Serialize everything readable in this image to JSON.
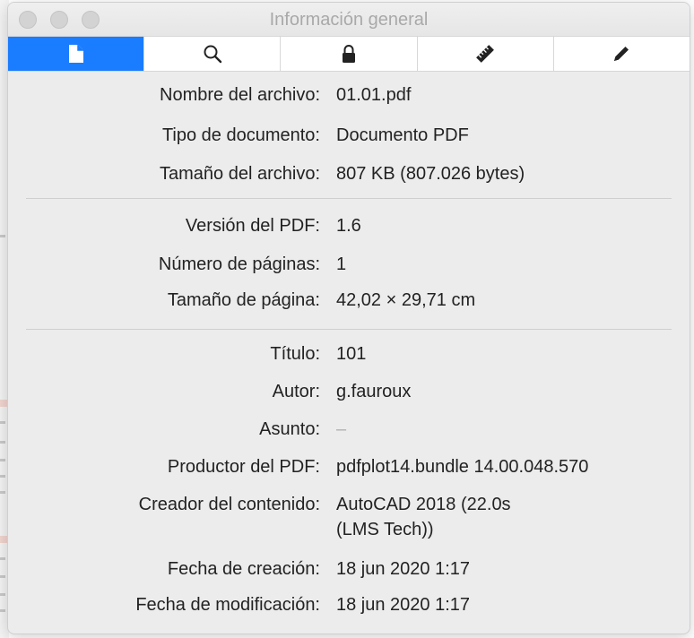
{
  "window": {
    "title": "Información general"
  },
  "tabs": [
    {
      "name": "tab-general",
      "icon": "document-icon",
      "active": true
    },
    {
      "name": "tab-search",
      "icon": "search-icon",
      "active": false
    },
    {
      "name": "tab-security",
      "icon": "lock-icon",
      "active": false
    },
    {
      "name": "tab-crop",
      "icon": "ruler-icon",
      "active": false
    },
    {
      "name": "tab-annotations",
      "icon": "pencil-icon",
      "active": false
    }
  ],
  "colors": {
    "accent": "#1a7dff",
    "window_bg": "#ececec"
  },
  "file_info": {
    "filename_label": "Nombre del archivo:",
    "filename_value": "01.01.pdf",
    "doctype_label": "Tipo de documento:",
    "doctype_value": "Documento PDF",
    "filesize_label": "Tamaño del archivo:",
    "filesize_value": "807 KB (807.026 bytes)"
  },
  "pdf_info": {
    "version_label": "Versión del PDF:",
    "version_value": "1.6",
    "pages_label": "Número de páginas:",
    "pages_value": "1",
    "pagesize_label": "Tamaño de página:",
    "pagesize_value": "42,02 × 29,71 cm"
  },
  "metadata": {
    "title_label": "Título:",
    "title_value": "101",
    "author_label": "Autor:",
    "author_value": "g.fauroux",
    "subject_label": "Asunto:",
    "subject_value": "–",
    "producer_label": "Productor del PDF:",
    "producer_value": "pdfplot14.bundle 14.00.048.570",
    "creator_label": "Creador del contenido:",
    "creator_value_line1": "AutoCAD 2018 (22.0s",
    "creator_value_line2": "(LMS Tech))",
    "created_label": "Fecha de creación:",
    "created_value": "18 jun 2020 1:17",
    "modified_label": "Fecha de modificación:",
    "modified_value": "18 jun 2020 1:17"
  }
}
